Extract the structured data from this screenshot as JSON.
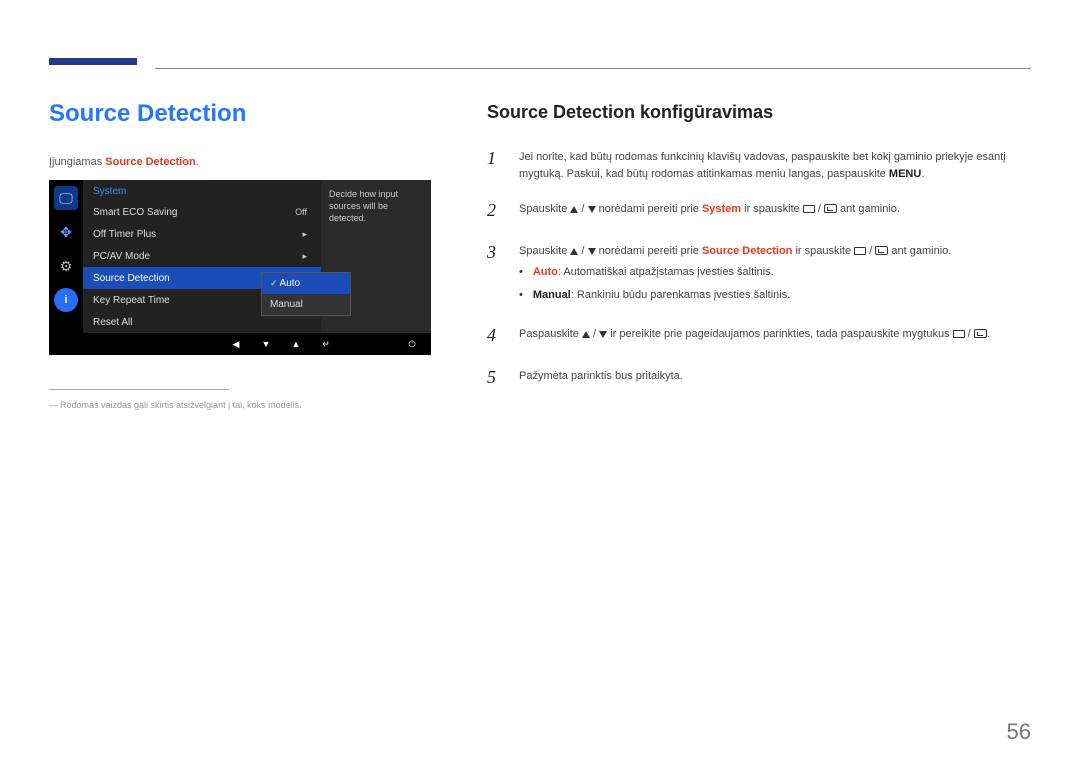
{
  "page_number": "56",
  "left": {
    "heading": "Source Detection",
    "intro_pre": "Įjungiamas ",
    "intro_kw": "Source Detection",
    "intro_post": ".",
    "footnote": "Rodomas vaizdas gali skirtis atsižvelgiant į tai, koks modelis."
  },
  "osd": {
    "section_title": "System",
    "tip": "Decide how input sources will be detected.",
    "rows": {
      "r0_label": "Smart ECO Saving",
      "r0_val": "Off",
      "r1_label": "Off Timer Plus",
      "r1_val": "▸",
      "r2_label": "PC/AV Mode",
      "r2_val": "▸",
      "r3_label": "Source Detection",
      "r3_val": "Auto",
      "r4_label": "Key Repeat Time",
      "r4_val": "",
      "r5_label": "Reset All",
      "r5_val": ""
    },
    "submenu": {
      "opt0": "Auto",
      "opt1": "Manual"
    },
    "footer": {
      "left": "◀",
      "down": "▼",
      "up": "▲",
      "enter": "↵",
      "power": "⏻"
    }
  },
  "right": {
    "heading": "Source Detection konfigūravimas",
    "step1_a": "Jei norite, kad būtų rodomas funkcinių klavišų vadovas, paspauskite bet kokį gaminio priekyje esantį mygtuką. Paskui, kad būtų rodomas atitinkamas meniu langas, paspauskite ",
    "step1_menu": "MENU",
    "step1_b": ".",
    "step2_a": "Spauskite ",
    "step2_mid": " norėdami pereiti prie ",
    "step2_kw": "System",
    "step2_b": " ir spauskite ",
    "step2_c": " ant gaminio.",
    "step3_a": "Spauskite ",
    "step3_mid": " norėdami pereiti prie ",
    "step3_kw": "Source Detection",
    "step3_b": " ir spauskite ",
    "step3_c": " ant gaminio.",
    "bullet_auto_kw": "Auto",
    "bullet_auto": ": Automatiškai atpažįstamas įvesties šaltinis.",
    "bullet_manual_kw": "Manual",
    "bullet_manual": ": Rankiniu būdu parenkamas įvesties šaltinis.",
    "step4_a": "Paspauskite ",
    "step4_mid": " ir pereikite prie pageidaujamos parinkties, tada paspauskite mygtukus ",
    "step4_b": ".",
    "step5": "Pažymėta parinktis bus pritaikyta."
  }
}
